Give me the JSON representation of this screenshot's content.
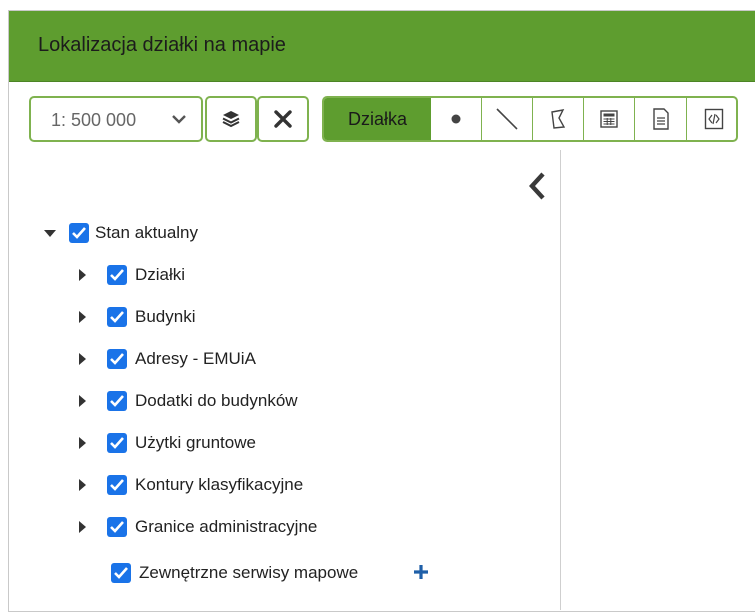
{
  "window": {
    "title": "Lokalizacja działki na mapie"
  },
  "toolbar": {
    "scale_value": "1: 500 000",
    "active_tool_label": "Działka",
    "icons": [
      "layers-icon",
      "close-icon",
      "point-icon",
      "line-icon",
      "polygon-icon",
      "calculator-icon",
      "document-icon",
      "code-file-icon"
    ]
  },
  "tree": {
    "root": {
      "label": "Stan aktualny",
      "checked": true,
      "expanded": true
    },
    "items": [
      {
        "label": "Działki",
        "checked": true
      },
      {
        "label": "Budynki",
        "checked": true
      },
      {
        "label": "Adresy - EMUiA",
        "checked": true
      },
      {
        "label": "Dodatki do budynków",
        "checked": true
      },
      {
        "label": "Użytki gruntowe",
        "checked": true
      },
      {
        "label": "Kontury klasyfikacyjne",
        "checked": true
      },
      {
        "label": "Granice administracyjne",
        "checked": true
      }
    ],
    "external": {
      "label": "Zewnętrzne serwisy mapowe",
      "checked": true
    }
  },
  "colors": {
    "header": "#5e9d2f",
    "border": "#7fb24f",
    "checkbox": "#1a73e8"
  }
}
